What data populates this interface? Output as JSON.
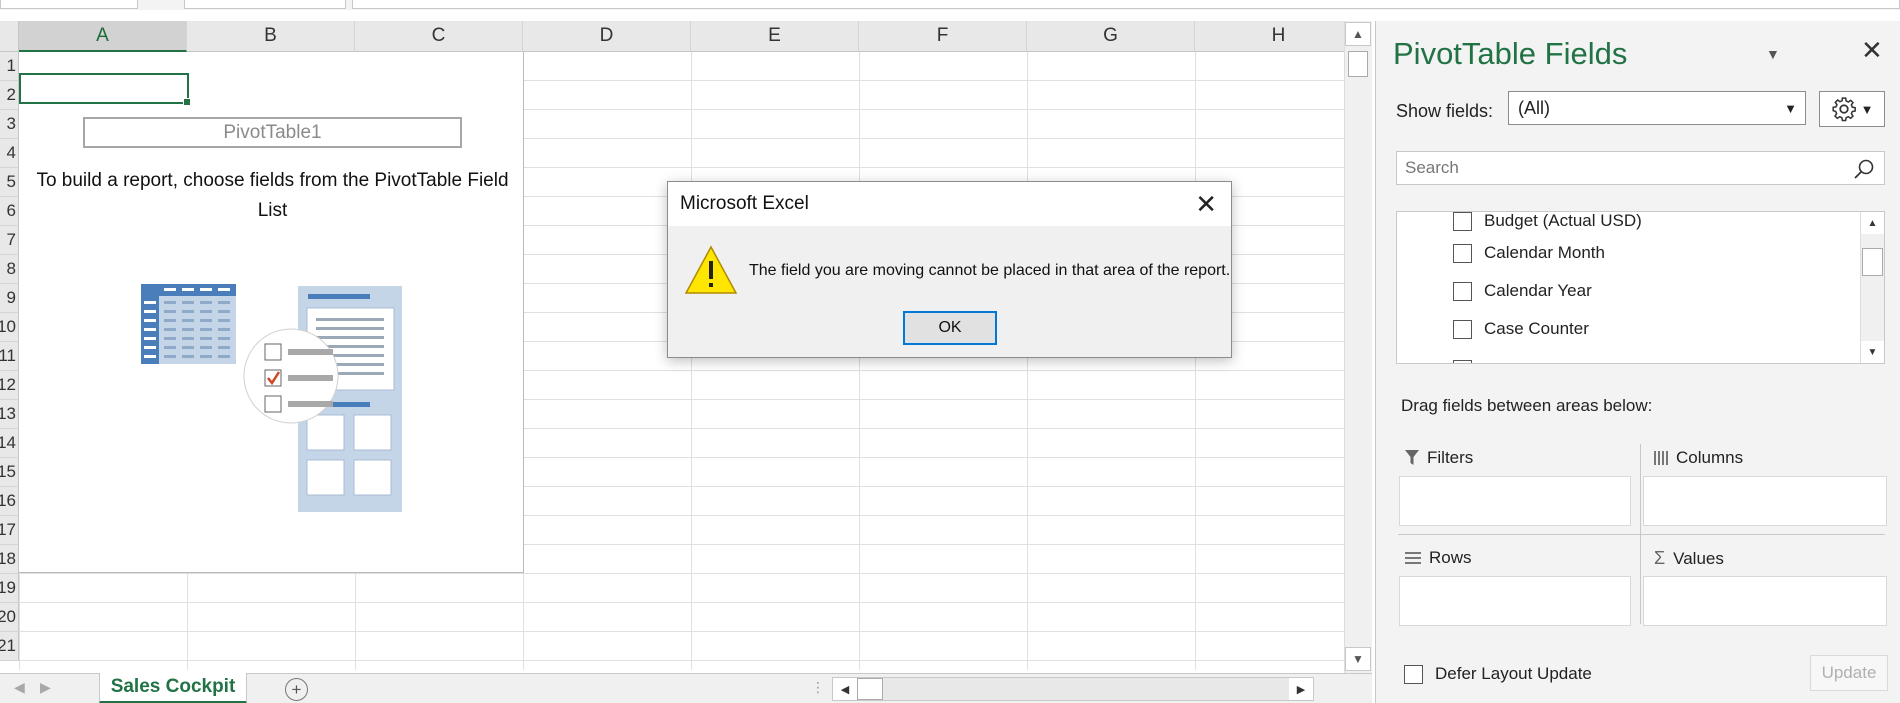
{
  "sheet": {
    "columns": [
      "A",
      "B",
      "C",
      "D",
      "E",
      "F",
      "G",
      "H"
    ],
    "rows": [
      "1",
      "2",
      "3",
      "4",
      "5",
      "6",
      "7",
      "8",
      "9",
      "10",
      "11",
      "12",
      "13",
      "14",
      "15",
      "16",
      "17",
      "18",
      "19",
      "20",
      "21"
    ],
    "selected_column": "A",
    "pivot_name": "PivotTable1",
    "pivot_message": "To build a report, choose fields from the PivotTable Field List",
    "tab_name": "Sales Cockpit",
    "add_sheet_label": "+"
  },
  "dialog": {
    "title": "Microsoft Excel",
    "message": "The field you are moving cannot be placed in that area of the report.",
    "ok_label": "OK",
    "close_glyph": "✕",
    "icon": "warning-icon",
    "warning_color": "#ffe600"
  },
  "panel": {
    "title": "PivotTable Fields",
    "close_glyph": "✕",
    "show_fields_label": "Show fields:",
    "show_fields_value": "(All)",
    "search_placeholder": "Search",
    "fields": [
      "Budget (Actual USD)",
      "Calendar Month",
      "Calendar Year",
      "Case Counter"
    ],
    "drag_label": "Drag fields between areas below:",
    "areas": {
      "filters": "Filters",
      "columns": "Columns",
      "rows": "Rows",
      "values": "Values"
    },
    "defer_label": "Defer Layout Update",
    "update_label": "Update"
  },
  "colors": {
    "accent": "#217346",
    "dialog_focus": "#0078d7",
    "illustration_blue": "#4a7ebb",
    "illustration_light": "#c5d5e8",
    "check_red": "#d24726"
  }
}
